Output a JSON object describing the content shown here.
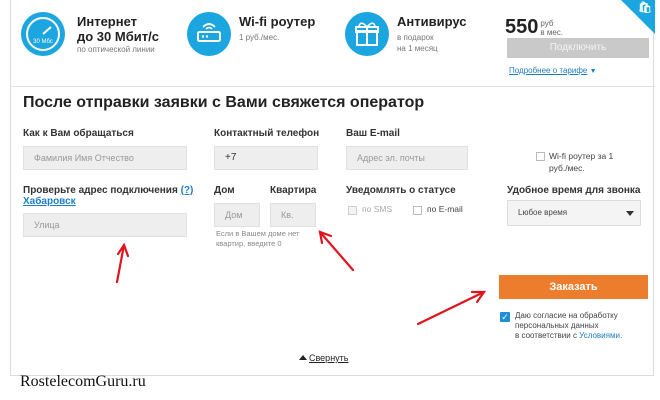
{
  "features": [
    {
      "title_line1": "Интернет",
      "title_line2": "до 30 Мбит/с",
      "sub": "по оптической линии",
      "icon_text": "30 Мбс",
      "icon": "speedometer-icon"
    },
    {
      "title": "Wi-fi роутер",
      "sub": "1 руб./мес.",
      "icon": "router-icon"
    },
    {
      "title": "Антивирус",
      "sub_line1": "в подарок",
      "sub_line2": "на 1 месяц",
      "icon": "gift-icon"
    }
  ],
  "price": {
    "value": "550",
    "unit_line1": "руб",
    "unit_line2": "в мес."
  },
  "connect_button": "Подключить",
  "tariff_link": "Подробнее о тарифе",
  "corner_badge_icon": "bag-icon",
  "corner_badge_count": "3",
  "form": {
    "heading": "После отправки заявки с Вами свяжется оператор",
    "name_label": "Как к Вам обращаться",
    "name_placeholder": "Фамилия Имя Отчество",
    "phone_label": "Контактный телефон",
    "phone_value": "+7",
    "email_label": "Ваш E-mail",
    "email_placeholder": "Адрес эл. почты",
    "router_check_line1": "Wi-fi роутер за 1",
    "router_check_line2": "руб./мес.",
    "address_label": "Проверьте адрес подключения",
    "address_help": "(?)",
    "city": "Хабаровск",
    "street_placeholder": "Улица",
    "house_label": "Дом",
    "house_placeholder": "Дом",
    "apt_label": "Квартира",
    "apt_placeholder": "Кв.",
    "apt_hint_line1": "Если в Вашем доме нет",
    "apt_hint_line2": "квартир, введите 0",
    "notify_label": "Уведомлять о статусе",
    "notify_sms": "по SMS",
    "notify_email": "по E-mail",
    "call_time_label": "Удобное время для звонка",
    "call_time_value": "Lюбое время"
  },
  "order_button": "Заказать",
  "agreement": {
    "line1": "Даю согласие на обработку",
    "line2": "персональных данных",
    "line3_pre": "в соответствии с ",
    "link": "Условиями",
    "line3_post": "."
  },
  "collapse": "Свернуть",
  "watermark": "RostelecomGuru.ru",
  "colors": {
    "accent": "#1ba6df",
    "order": "#ec7d2c",
    "link": "#1d7ec5",
    "arrow": "#e0141e"
  }
}
